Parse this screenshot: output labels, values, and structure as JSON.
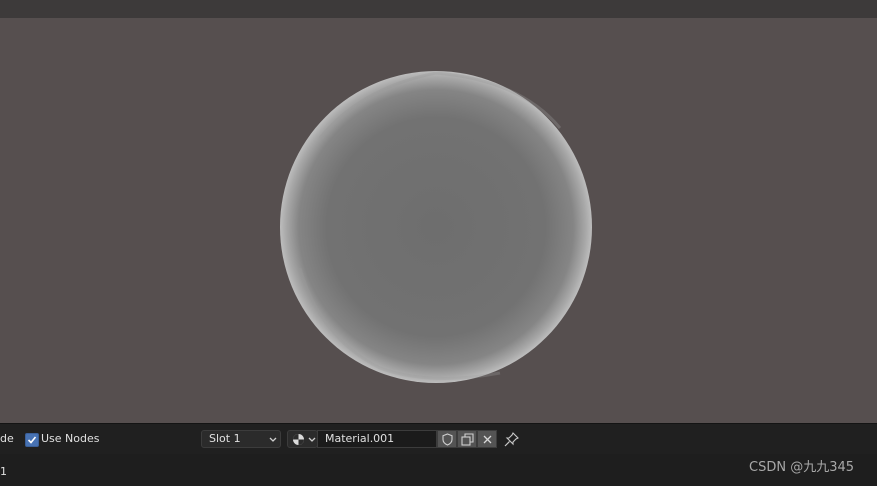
{
  "viewport": {
    "background": "#564f4f",
    "sphere_color": "#7a7a7a"
  },
  "bottom_bar": {
    "left_cut_label": "de",
    "use_nodes_label": "Use Nodes",
    "use_nodes_checked": true,
    "slot_selected": "Slot 1",
    "material_name": "Material.001",
    "browse_icon": "material-sphere-icon",
    "fake_user_icon": "shield-icon",
    "duplicate_icon": "duplicate-icon",
    "unlink_icon": "close-icon",
    "pin_icon": "pin-icon"
  },
  "bottom_row2": {
    "left_cut_label": "1"
  },
  "watermark": "CSDN @九九345"
}
